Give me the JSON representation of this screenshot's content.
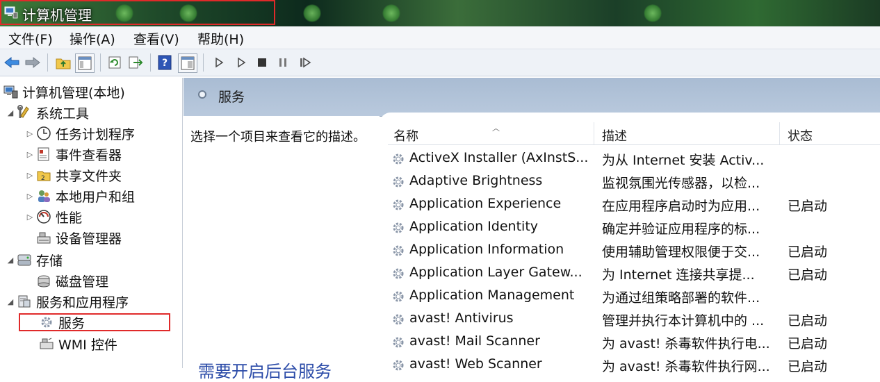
{
  "window": {
    "title": "计算机管理"
  },
  "menu": [
    "文件(F)",
    "操作(A)",
    "查看(V)",
    "帮助(H)"
  ],
  "toolbar": {
    "buttons": [
      "back-icon",
      "forward-icon",
      "up-folder-icon",
      "show-hide-tree-icon",
      "refresh-icon",
      "export-icon",
      "help-icon",
      "properties-icon",
      "play-icon",
      "play-alt-icon",
      "stop-icon",
      "pause-icon",
      "restart-icon"
    ]
  },
  "tree": {
    "root": "计算机管理(本地)",
    "system_tools": "系统工具",
    "task_scheduler": "任务计划程序",
    "event_viewer": "事件查看器",
    "shared_folders": "共享文件夹",
    "local_users": "本地用户和组",
    "performance": "性能",
    "device_manager": "设备管理器",
    "storage": "存储",
    "disk_management": "磁盘管理",
    "services_apps": "服务和应用程序",
    "services": "服务",
    "wmi": "WMI 控件"
  },
  "panel": {
    "title": "服务",
    "description_hint": "选择一个项目来查看它的描述。",
    "annotation": "需要开启后台服务"
  },
  "columns": {
    "name": "名称",
    "description": "描述",
    "status": "状态"
  },
  "services": [
    {
      "name": "ActiveX Installer (AxInstS...",
      "description": "为从 Internet 安装 Activ...",
      "status": ""
    },
    {
      "name": "Adaptive Brightness",
      "description": "监视氛围光传感器，以检...",
      "status": ""
    },
    {
      "name": "Application Experience",
      "description": "在应用程序启动时为应用...",
      "status": "已启动"
    },
    {
      "name": "Application Identity",
      "description": "确定并验证应用程序的标...",
      "status": ""
    },
    {
      "name": "Application Information",
      "description": "使用辅助管理权限便于交...",
      "status": "已启动"
    },
    {
      "name": "Application Layer Gatew...",
      "description": "为 Internet 连接共享提...",
      "status": "已启动"
    },
    {
      "name": "Application Management",
      "description": "为通过组策略部署的软件...",
      "status": ""
    },
    {
      "name": "avast! Antivirus",
      "description": "管理并执行本计算机中的 ...",
      "status": "已启动"
    },
    {
      "name": "avast! Mail Scanner",
      "description": "为 avast! 杀毒软件执行电...",
      "status": "已启动"
    },
    {
      "name": "avast! Web Scanner",
      "description": "为 avast! 杀毒软件执行网...",
      "status": "已启动"
    }
  ],
  "colors": {
    "highlight_box": "#e02a2a",
    "annotation_text": "#2b4ba8",
    "panel_header": "#b3c4da"
  }
}
